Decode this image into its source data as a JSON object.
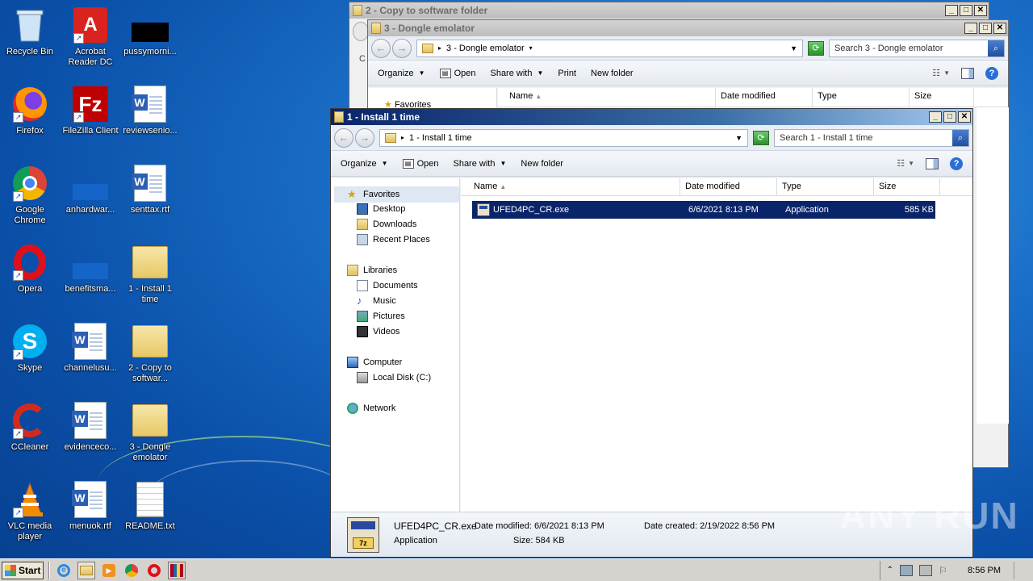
{
  "desktop": {
    "icons": [
      {
        "label": "Recycle Bin"
      },
      {
        "label": "Acrobat Reader DC"
      },
      {
        "label": "pussymorni..."
      },
      {
        "label": "Firefox"
      },
      {
        "label": "FileZilla Client"
      },
      {
        "label": "reviewsenio..."
      },
      {
        "label": "Google Chrome"
      },
      {
        "label": "anhardwar..."
      },
      {
        "label": "senttax.rtf"
      },
      {
        "label": "Opera"
      },
      {
        "label": "benefitsma..."
      },
      {
        "label": "1 - Install 1 time"
      },
      {
        "label": "Skype"
      },
      {
        "label": "channelusu..."
      },
      {
        "label": "2 - Copy to softwar..."
      },
      {
        "label": "CCleaner"
      },
      {
        "label": "evidenceco..."
      },
      {
        "label": "3 - Dongle emolator"
      },
      {
        "label": "VLC media player"
      },
      {
        "label": "menuok.rtf"
      },
      {
        "label": "README.txt"
      }
    ],
    "watermark": "ANY RUN"
  },
  "window_back": {
    "title": "2 - Copy to software folder",
    "partial_col": "C"
  },
  "window_mid": {
    "title": "3 - Dongle emolator",
    "address": "3 - Dongle emolator",
    "search_placeholder": "Search 3 - Dongle emolator",
    "cmd": {
      "organize": "Organize",
      "open": "Open",
      "share": "Share with",
      "print": "Print",
      "new_folder": "New folder"
    },
    "nav_partial": "Favorites",
    "columns": {
      "name": "Name",
      "date": "Date modified",
      "type": "Type",
      "size": "Size"
    }
  },
  "window_front": {
    "title": "1 - Install 1 time",
    "address": "1 - Install 1 time",
    "search_placeholder": "Search 1 - Install 1 time",
    "cmd": {
      "organize": "Organize",
      "open": "Open",
      "share": "Share with",
      "new_folder": "New folder"
    },
    "nav": {
      "favorites": "Favorites",
      "desktop": "Desktop",
      "downloads": "Downloads",
      "recent": "Recent Places",
      "libraries": "Libraries",
      "documents": "Documents",
      "music": "Music",
      "pictures": "Pictures",
      "videos": "Videos",
      "computer": "Computer",
      "localdisk": "Local Disk (C:)",
      "network": "Network"
    },
    "columns": {
      "name": "Name",
      "date": "Date modified",
      "type": "Type",
      "size": "Size"
    },
    "file": {
      "name": "UFED4PC_CR.exe",
      "date": "6/6/2021 8:13 PM",
      "type": "Application",
      "size": "585 KB"
    },
    "details": {
      "name": "UFED4PC_CR.exe",
      "type": "Application",
      "date_modified_label": "Date modified:",
      "date_modified": "6/6/2021 8:13 PM",
      "size_label": "Size:",
      "size": "584 KB",
      "date_created_label": "Date created:",
      "date_created": "2/19/2022 8:56 PM",
      "icon_text": "7z"
    }
  },
  "taskbar": {
    "start": "Start",
    "clock": "8:56 PM"
  }
}
